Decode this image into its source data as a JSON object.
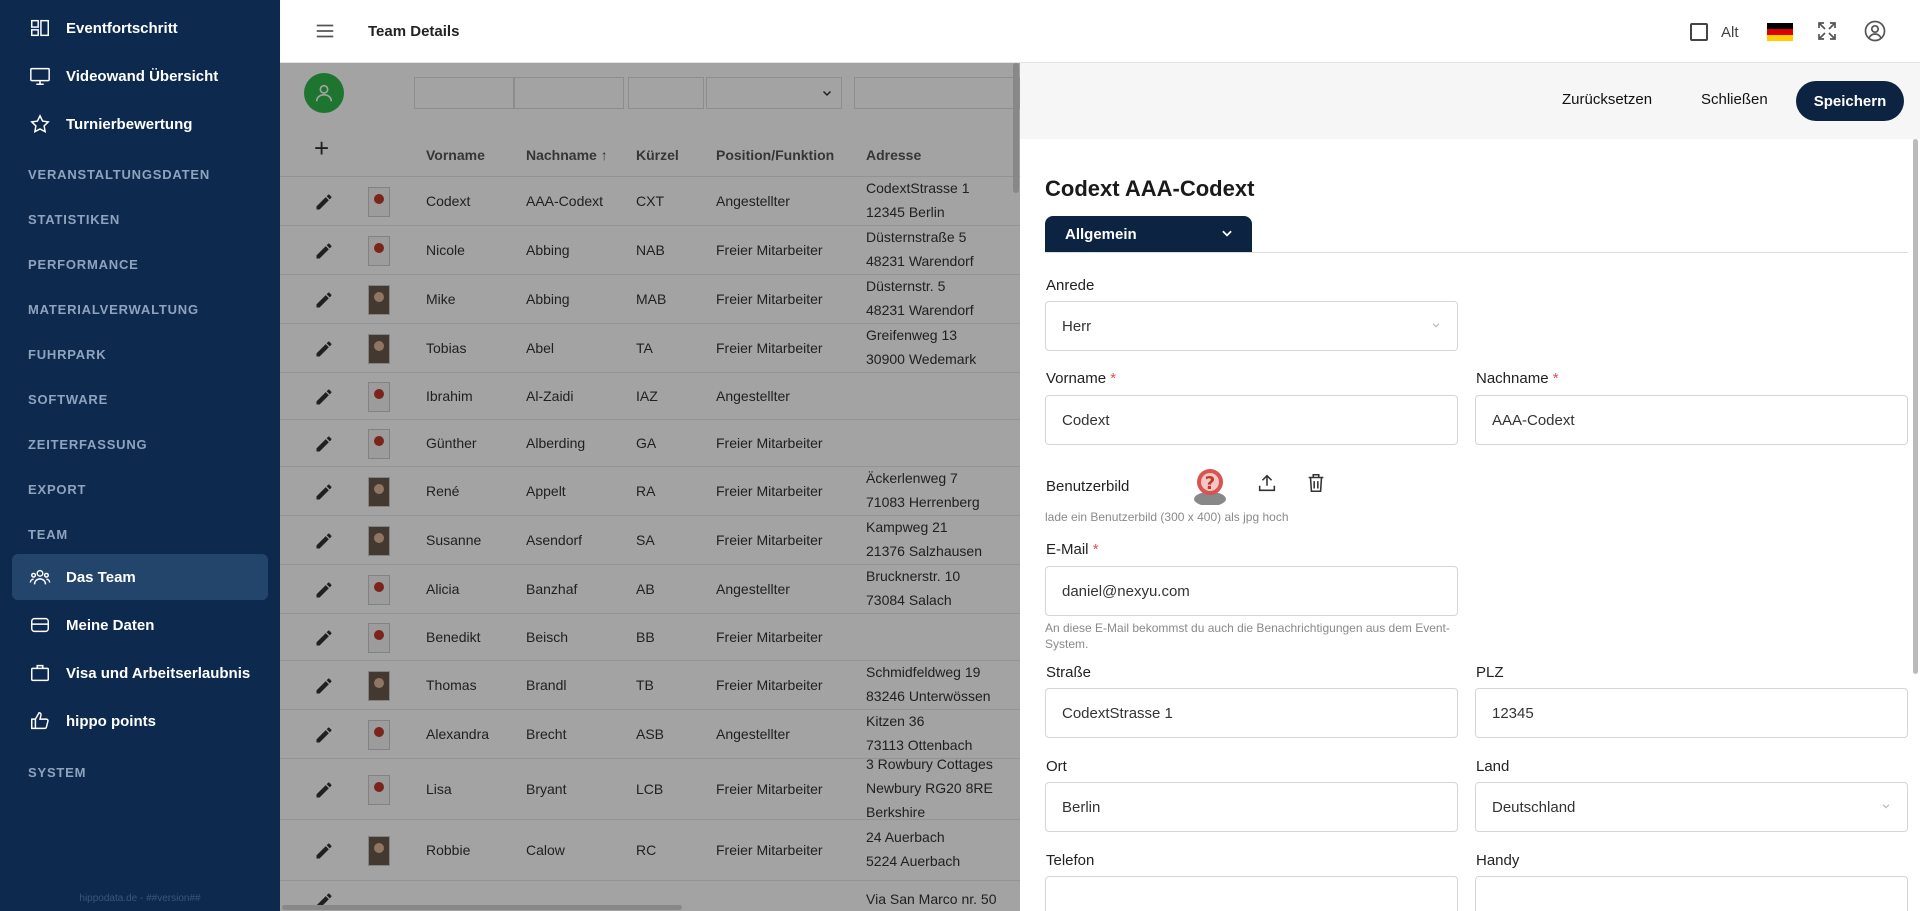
{
  "sidebar": {
    "items_top": [
      {
        "label": "Eventfortschritt",
        "icon": "dashboard-icon"
      },
      {
        "label": "Videowand Übersicht",
        "icon": "monitor-icon"
      },
      {
        "label": "Turnierbewertung",
        "icon": "star-icon"
      }
    ],
    "sections": [
      "VERANSTALTUNGSDATEN",
      "STATISTIKEN",
      "PERFORMANCE",
      "MATERIALVERWALTUNG",
      "FUHRPARK",
      "SOFTWARE",
      "ZEITERFASSUNG",
      "EXPORT",
      "TEAM"
    ],
    "team_items": [
      {
        "label": "Das Team",
        "icon": "team-icon",
        "active": true
      },
      {
        "label": "Meine Daten",
        "icon": "database-icon"
      },
      {
        "label": "Visa und Arbeitserlaubnis",
        "icon": "briefcase-icon"
      },
      {
        "label": "hippo points",
        "icon": "thumbs-up-icon"
      }
    ],
    "system_section": "SYSTEM",
    "footer": "hippodata.de - ##version##"
  },
  "topbar": {
    "title": "Team Details",
    "alt_label": "Alt",
    "flag_colors": [
      "#000000",
      "#dd0000",
      "#ffce00"
    ]
  },
  "table": {
    "columns": [
      "Vorname",
      "Nachname",
      "Kürzel",
      "Position/Funktion",
      "Adresse"
    ],
    "sort_column": "Nachname",
    "rows": [
      {
        "vorname": "Codext",
        "nachname": "AAA-Codext",
        "kuerzel": "CXT",
        "position": "Angestellter",
        "adresse1": "CodextStrasse 1",
        "adresse2": "12345 Berlin",
        "adresse3": "",
        "photo": false
      },
      {
        "vorname": "Nicole",
        "nachname": "Abbing",
        "kuerzel": "NAB",
        "position": "Freier Mitarbeiter",
        "adresse1": "Düsternstraße 5",
        "adresse2": "48231 Warendorf",
        "adresse3": "",
        "photo": false
      },
      {
        "vorname": "Mike",
        "nachname": "Abbing",
        "kuerzel": "MAB",
        "position": "Freier Mitarbeiter",
        "adresse1": "Düsternstr. 5",
        "adresse2": "48231 Warendorf",
        "adresse3": "",
        "photo": true
      },
      {
        "vorname": "Tobias",
        "nachname": "Abel",
        "kuerzel": "TA",
        "position": "Freier Mitarbeiter",
        "adresse1": "Greifenweg 13",
        "adresse2": "30900 Wedemark",
        "adresse3": "",
        "photo": true
      },
      {
        "vorname": "Ibrahim",
        "nachname": "Al-Zaidi",
        "kuerzel": "IAZ",
        "position": "Angestellter",
        "adresse1": "",
        "adresse2": "",
        "adresse3": "",
        "photo": false
      },
      {
        "vorname": "Günther",
        "nachname": "Alberding",
        "kuerzel": "GA",
        "position": "Freier Mitarbeiter",
        "adresse1": "",
        "adresse2": "",
        "adresse3": "",
        "photo": false
      },
      {
        "vorname": "René",
        "nachname": "Appelt",
        "kuerzel": "RA",
        "position": "Freier Mitarbeiter",
        "adresse1": "Äckerlenweg 7",
        "adresse2": "71083 Herrenberg",
        "adresse3": "",
        "photo": true
      },
      {
        "vorname": "Susanne",
        "nachname": "Asendorf",
        "kuerzel": "SA",
        "position": "Freier Mitarbeiter",
        "adresse1": "Kampweg 21",
        "adresse2": "21376 Salzhausen",
        "adresse3": "",
        "photo": true
      },
      {
        "vorname": "Alicia",
        "nachname": "Banzhaf",
        "kuerzel": "AB",
        "position": "Angestellter",
        "adresse1": "Brucknerstr. 10",
        "adresse2": "73084 Salach",
        "adresse3": "",
        "photo": false
      },
      {
        "vorname": "Benedikt",
        "nachname": "Beisch",
        "kuerzel": "BB",
        "position": "Freier Mitarbeiter",
        "adresse1": "",
        "adresse2": "",
        "adresse3": "",
        "photo": false
      },
      {
        "vorname": "Thomas",
        "nachname": "Brandl",
        "kuerzel": "TB",
        "position": "Freier Mitarbeiter",
        "adresse1": "Schmidfeldweg 19",
        "adresse2": "83246 Unterwössen",
        "adresse3": "",
        "photo": true
      },
      {
        "vorname": "Alexandra",
        "nachname": "Brecht",
        "kuerzel": "ASB",
        "position": "Angestellter",
        "adresse1": "Kitzen 36",
        "adresse2": "73113 Ottenbach",
        "adresse3": "",
        "photo": false
      },
      {
        "vorname": "Lisa",
        "nachname": "Bryant",
        "kuerzel": "LCB",
        "position": "Freier Mitarbeiter",
        "adresse1": "3 Rowbury Cottages",
        "adresse2": "Newbury RG20 8RE",
        "adresse3": "Berkshire",
        "photo": false
      },
      {
        "vorname": "Robbie",
        "nachname": "Calow",
        "kuerzel": "RC",
        "position": "Freier Mitarbeiter",
        "adresse1": "24 Auerbach",
        "adresse2": "5224 Auerbach",
        "adresse3": "",
        "photo": true
      },
      {
        "vorname": "",
        "nachname": "",
        "kuerzel": "",
        "position": "",
        "adresse1": "Via San Marco nr. 50",
        "adresse2": "",
        "adresse3": "",
        "photo": false
      }
    ]
  },
  "panel": {
    "reset_label": "Zurücksetzen",
    "close_label": "Schließen",
    "save_label": "Speichern",
    "person_title": "Codext AAA-Codext",
    "tab_label": "Allgemein",
    "form": {
      "anrede_label": "Anrede",
      "anrede_value": "Herr",
      "vorname_label": "Vorname",
      "vorname_value": "Codext",
      "nachname_label": "Nachname",
      "nachname_value": "AAA-Codext",
      "required_mark": "*",
      "benutzerbild_label": "Benutzerbild",
      "benutzerbild_hint": "lade ein Benutzerbild (300 x 400) als jpg hoch",
      "email_label": "E-Mail",
      "email_value": "daniel@nexyu.com",
      "email_hint": "An diese E-Mail bekommst du auch die Benachrichtigungen aus dem Event-System.",
      "strasse_label": "Straße",
      "strasse_value": "CodextStrasse 1",
      "plz_label": "PLZ",
      "plz_value": "12345",
      "ort_label": "Ort",
      "ort_value": "Berlin",
      "land_label": "Land",
      "land_value": "Deutschland",
      "telefon_label": "Telefon",
      "telefon_value": "",
      "handy_label": "Handy",
      "handy_value": ""
    }
  }
}
